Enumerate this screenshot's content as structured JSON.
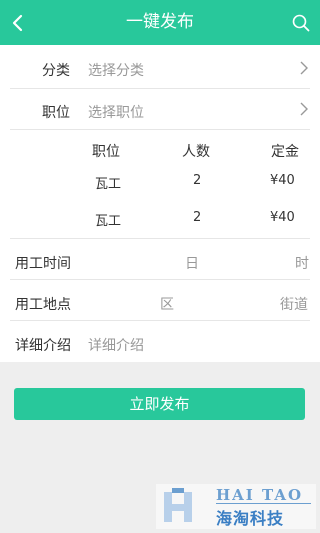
{
  "header": {
    "title": "一键发布",
    "back_icon": "chevron-left-icon",
    "search_icon": "search-icon",
    "color": "#28c89b"
  },
  "form": {
    "category": {
      "label": "分类",
      "placeholder": "选择分类"
    },
    "position": {
      "label": "职位",
      "placeholder": "选择职位"
    },
    "positions_table": {
      "headers": [
        "职位",
        "人数",
        "定金"
      ],
      "rows": [
        {
          "position": "瓦工",
          "count": "2",
          "deposit": "¥40"
        },
        {
          "position": "瓦工",
          "count": "2",
          "deposit": "¥40"
        }
      ]
    },
    "work_time": {
      "label": "用工时间",
      "day_unit": "日",
      "hour_unit": "时"
    },
    "work_location": {
      "label": "用工地点",
      "district": "区",
      "street": "街道"
    },
    "details": {
      "label": "详细介绍",
      "placeholder": "详细介绍"
    }
  },
  "submit_label": "立即发布",
  "watermark": {
    "text_en": "HAI TAO",
    "text_cn": "海淘科技"
  }
}
